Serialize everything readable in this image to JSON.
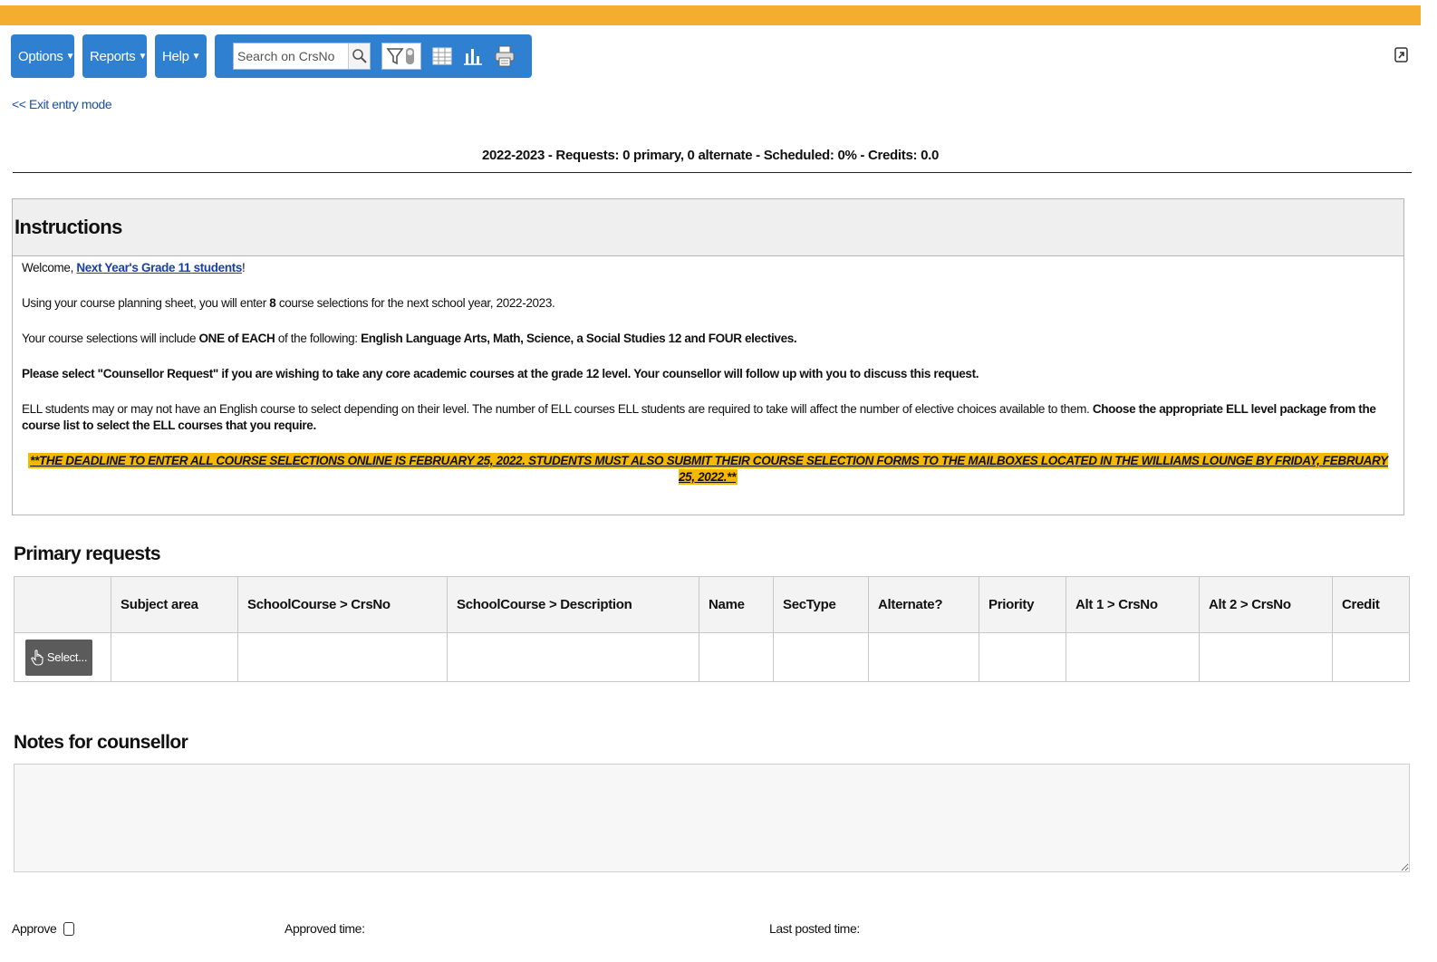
{
  "colors": {
    "topbar": "#f5ad30",
    "toolbar": "#2f80d0",
    "deadline_highlight": "#f5b800"
  },
  "toolbar": {
    "options_label": "Options",
    "reports_label": "Reports",
    "help_label": "Help",
    "search_placeholder": "Search on CrsNo",
    "icons": [
      "search-icon",
      "filter-icon",
      "grid-icon",
      "chart-icon",
      "print-icon"
    ]
  },
  "exit_link": "<< Exit entry mode",
  "summary": "2022-2023 - Requests: 0 primary, 0 alternate - Scheduled: 0% - Credits: 0.0",
  "instructions": {
    "title": "Instructions",
    "welcome_prefix": "Welcome, ",
    "welcome_link": "Next Year's Grade 11 students",
    "welcome_suffix": "!",
    "p1_a": "Using your course planning sheet, you will enter ",
    "p1_b": "8",
    "p1_c": " course selections for the next school year, 2022-2023.",
    "p2_a": "Your course selections will include ",
    "p2_b": "ONE of EACH",
    "p2_c": " of the following: ",
    "p2_d": "English Language Arts, Math, Science, a Social Studies 12 and FOUR electives.",
    "p3": "Please select \"Counsellor Request\" if you are wishing to take any core academic courses at the grade 12 level. Your counsellor will follow up with you to discuss this request.",
    "p4_a": "ELL students may or may not have an English course to select depending on their level. The number of ELL courses ELL students are required to take will affect the number of elective choices available to them. ",
    "p4_b": "Choose the appropriate ELL level package from the course list to select the ELL courses that you require.",
    "deadline": "**THE DEADLINE TO ENTER ALL COURSE SELECTIONS ONLINE  IS FEBRUARY 25, 2022.  STUDENTS MUST ALSO SUBMIT THEIR COURSE SELECTION FORMS TO THE MAILBOXES LOCATED IN THE WILLIAMS LOUNGE BY FRIDAY, FEBRUARY 25, 2022.**"
  },
  "primary": {
    "title": "Primary requests",
    "columns": [
      "",
      "Subject area",
      "SchoolCourse > CrsNo",
      "SchoolCourse > Description",
      "Name",
      "SecType",
      "Alternate?",
      "Priority",
      "Alt 1 > CrsNo",
      "Alt 2 > CrsNo",
      "Credit"
    ],
    "select_label": "Select..."
  },
  "notes": {
    "title": "Notes for counsellor",
    "value": ""
  },
  "footer": {
    "approve_label": "Approve",
    "approved_time_label": "Approved time:",
    "last_posted_label": "Last posted time:"
  }
}
